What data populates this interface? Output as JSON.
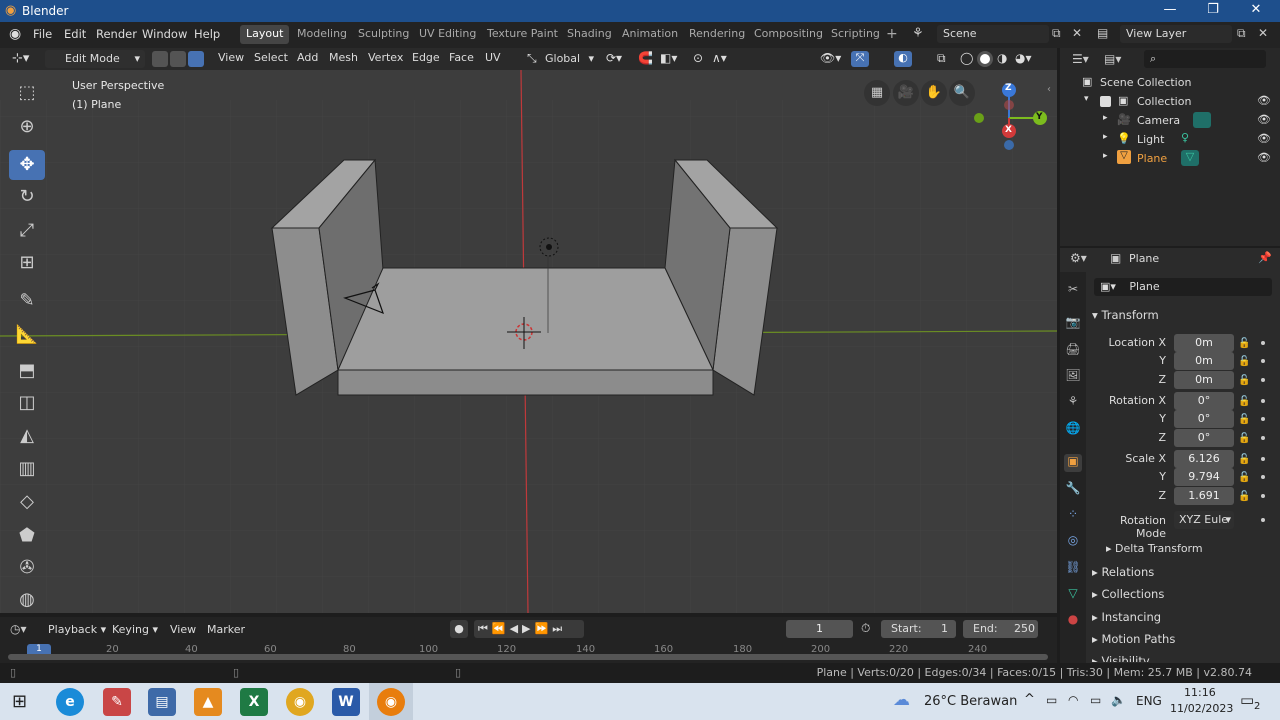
{
  "window": {
    "title": "Blender"
  },
  "menus": [
    "File",
    "Edit",
    "Render",
    "Window",
    "Help"
  ],
  "workspaces": [
    "Layout",
    "Modeling",
    "Sculpting",
    "UV Editing",
    "Texture Paint",
    "Shading",
    "Animation",
    "Rendering",
    "Compositing",
    "Scripting"
  ],
  "scene": "Scene",
  "view_layer": "View Layer",
  "viewport_header": {
    "mode": "Edit Mode",
    "menus": [
      "View",
      "Select",
      "Add",
      "Mesh",
      "Vertex",
      "Edge",
      "Face",
      "UV"
    ],
    "orientation": "Global"
  },
  "overlay_text": {
    "perspective": "User Perspective",
    "object": "(1) Plane"
  },
  "gizmo": {
    "x": "X",
    "y": "Y",
    "z": "Z"
  },
  "outliner": {
    "root": "Scene Collection",
    "collection": "Collection",
    "items": [
      "Camera",
      "Light",
      "Plane"
    ]
  },
  "properties": {
    "header": "Plane",
    "name_field": "Plane",
    "transform_title": "Transform",
    "location_label": "Location X",
    "rotation_label": "Rotation X",
    "scale_label": "Scale X",
    "y": "Y",
    "z": "Z",
    "location": [
      "0m",
      "0m",
      "0m"
    ],
    "rotation": [
      "0°",
      "0°",
      "0°"
    ],
    "scale": [
      "6.126",
      "9.794",
      "1.691"
    ],
    "rotation_mode_label": "Rotation Mode",
    "rotation_mode": "XYZ Eule",
    "sections": [
      "Delta Transform",
      "Relations",
      "Collections",
      "Instancing",
      "Motion Paths",
      "Visibility"
    ]
  },
  "timeline": {
    "menus": [
      "Playback",
      "Keying",
      "View",
      "Marker"
    ],
    "current_frame": "1",
    "start_label": "Start:",
    "start": "1",
    "end_label": "End:",
    "end": "250",
    "ruler": [
      "1",
      "20",
      "40",
      "60",
      "80",
      "100",
      "120",
      "140",
      "160",
      "180",
      "200",
      "220",
      "240"
    ]
  },
  "status": {
    "text": "Plane | Verts:0/20 | Edges:0/34 | Faces:0/15 | Tris:30 | Mem: 25.7 MB | v2.80.74"
  },
  "taskbar": {
    "weather": "26°C  Berawan",
    "lang": "ENG",
    "time": "11:16",
    "date": "11/02/2023",
    "notifications": "2",
    "apps": [
      "edge",
      "paint",
      "drive",
      "vlc",
      "excel",
      "chrome",
      "word",
      "blender"
    ]
  },
  "colors": {
    "accent": "#4772b3",
    "selected_object": "#f0a040",
    "titlebar": "#1e4f8c"
  }
}
